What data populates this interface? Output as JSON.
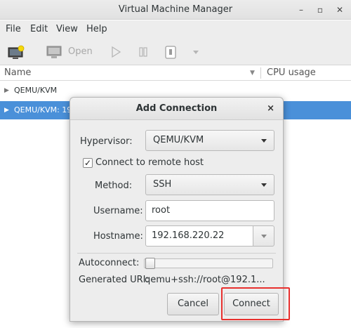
{
  "window": {
    "title": "Virtual Machine Manager",
    "minimize_icon": "minimize-icon",
    "maximize_icon": "maximize-icon",
    "close_icon": "close-icon"
  },
  "menu": {
    "items": [
      "File",
      "Edit",
      "View",
      "Help"
    ]
  },
  "toolbar": {
    "new_vm_icon": "new-vm-icon",
    "open_icon": "monitor-icon",
    "open_label": "Open",
    "run_icon": "play-icon",
    "pause_icon": "pause-icon",
    "shutdown_icon": "shutdown-icon",
    "menu_icon": "chevron-down-icon"
  },
  "list": {
    "columns": [
      "Name",
      "CPU usage"
    ],
    "rows": [
      {
        "label": "QEMU/KVM",
        "selected": false
      },
      {
        "label": "QEMU/KVM: 192",
        "selected": true
      }
    ]
  },
  "dialog": {
    "title": "Add Connection",
    "close": "×",
    "hypervisor_label": "Hypervisor:",
    "hypervisor_value": "QEMU/KVM",
    "remote_checkbox_label": "Connect to remote host",
    "remote_checked": true,
    "method_label": "Method:",
    "method_value": "SSH",
    "username_label": "Username:",
    "username_value": "root",
    "hostname_label": "Hostname:",
    "hostname_value": "192.168.220.22",
    "autoconnect_label": "Autoconnect:",
    "autoconnect_on": false,
    "uri_label": "Generated URI:",
    "uri_value": "qemu+ssh://root@192.1...",
    "cancel_label": "Cancel",
    "connect_label": "Connect"
  },
  "colors": {
    "selection": "#4a90d9",
    "highlight_box": "#e8302e"
  }
}
